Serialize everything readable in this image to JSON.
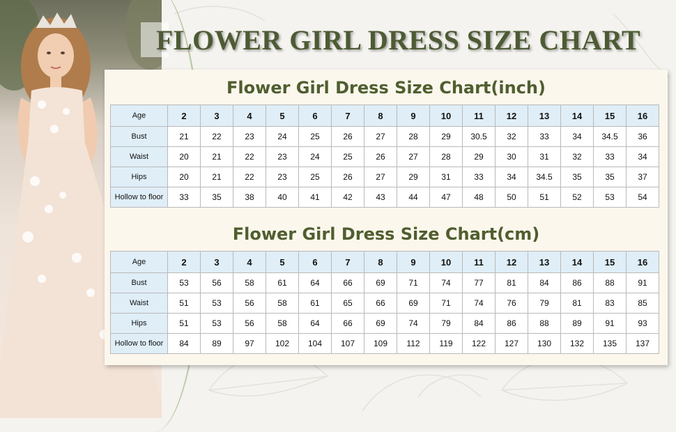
{
  "title": "FLOWER GIRL DRESS SIZE CHART",
  "inch_chart": {
    "title": "Flower Girl Dress Size Chart(inch)",
    "rows": [
      {
        "label": "Age",
        "values": [
          "2",
          "3",
          "4",
          "5",
          "6",
          "7",
          "8",
          "9",
          "10",
          "11",
          "12",
          "13",
          "14",
          "15",
          "16"
        ]
      },
      {
        "label": "Bust",
        "values": [
          "21",
          "22",
          "23",
          "24",
          "25",
          "26",
          "27",
          "28",
          "29",
          "30.5",
          "32",
          "33",
          "34",
          "34.5",
          "36"
        ]
      },
      {
        "label": "Waist",
        "values": [
          "20",
          "21",
          "22",
          "23",
          "24",
          "25",
          "26",
          "27",
          "28",
          "29",
          "30",
          "31",
          "32",
          "33",
          "34"
        ]
      },
      {
        "label": "Hips",
        "values": [
          "20",
          "21",
          "22",
          "23",
          "25",
          "26",
          "27",
          "29",
          "31",
          "33",
          "34",
          "34.5",
          "35",
          "35",
          "37"
        ]
      },
      {
        "label": "Hollow to floor",
        "values": [
          "33",
          "35",
          "38",
          "40",
          "41",
          "42",
          "43",
          "44",
          "47",
          "48",
          "50",
          "51",
          "52",
          "53",
          "54"
        ]
      }
    ]
  },
  "cm_chart": {
    "title": "Flower Girl Dress Size Chart(cm)",
    "rows": [
      {
        "label": "Age",
        "values": [
          "2",
          "3",
          "4",
          "5",
          "6",
          "7",
          "8",
          "9",
          "10",
          "11",
          "12",
          "13",
          "14",
          "15",
          "16"
        ]
      },
      {
        "label": "Bust",
        "values": [
          "53",
          "56",
          "58",
          "61",
          "64",
          "66",
          "69",
          "71",
          "74",
          "77",
          "81",
          "84",
          "86",
          "88",
          "91"
        ]
      },
      {
        "label": "Waist",
        "values": [
          "51",
          "53",
          "56",
          "58",
          "61",
          "65",
          "66",
          "69",
          "71",
          "74",
          "76",
          "79",
          "81",
          "83",
          "85"
        ]
      },
      {
        "label": "Hips",
        "values": [
          "51",
          "53",
          "56",
          "58",
          "64",
          "66",
          "69",
          "74",
          "79",
          "84",
          "86",
          "88",
          "89",
          "91",
          "93"
        ]
      },
      {
        "label": "Hollow to floor",
        "values": [
          "84",
          "89",
          "97",
          "102",
          "104",
          "107",
          "109",
          "112",
          "119",
          "122",
          "127",
          "130",
          "132",
          "135",
          "137"
        ]
      }
    ]
  },
  "colors": {
    "title": "#4d5b34",
    "section_title": "#4f5e2f",
    "header_fill": "#dfeef7",
    "panel": "#fcf7ed"
  }
}
